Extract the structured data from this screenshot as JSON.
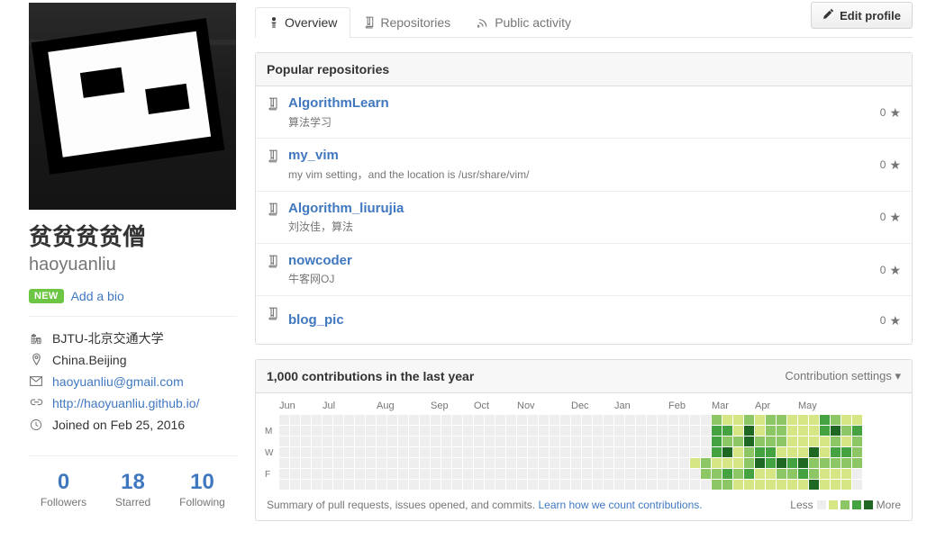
{
  "profile": {
    "display_name": "贫贫贫贫僧",
    "username": "haoyuanliu",
    "avatar_alt": "avatar-image",
    "new_badge": "NEW",
    "add_bio": "Add a bio",
    "meta": [
      {
        "icon": "organization-icon",
        "text": "BJTU-北京交通大学",
        "link": false
      },
      {
        "icon": "location-icon",
        "text": "China.Beijing",
        "link": false
      },
      {
        "icon": "mail-icon",
        "text": "haoyuanliu@gmail.com",
        "link": true
      },
      {
        "icon": "link-icon",
        "text": "http://haoyuanliu.github.io/",
        "link": true
      },
      {
        "icon": "clock-icon",
        "text": "Joined on Feb 25, 2016",
        "link": false
      }
    ],
    "stats": [
      {
        "num": "0",
        "label": "Followers"
      },
      {
        "num": "18",
        "label": "Starred"
      },
      {
        "num": "10",
        "label": "Following"
      }
    ]
  },
  "tabs": [
    {
      "label": "Overview",
      "icon": "person-icon",
      "active": true
    },
    {
      "label": "Repositories",
      "icon": "repo-icon",
      "active": false
    },
    {
      "label": "Public activity",
      "icon": "rss-icon",
      "active": false
    }
  ],
  "edit_profile": {
    "label": "Edit profile",
    "icon": "pencil-icon"
  },
  "popular_repositories": {
    "title": "Popular repositories",
    "items": [
      {
        "name": "AlgorithmLearn",
        "description": "算法学习",
        "stars": "0"
      },
      {
        "name": "my_vim",
        "description": "my vim setting，and the location is /usr/share/vim/",
        "stars": "0"
      },
      {
        "name": "Algorithm_liurujia",
        "description": "刘汝佳，算法",
        "stars": "0"
      },
      {
        "name": "nowcoder",
        "description": "牛客网OJ",
        "stars": "0"
      },
      {
        "name": "blog_pic",
        "description": "",
        "stars": "0"
      }
    ]
  },
  "contributions": {
    "title": "1,000 contributions in the last year",
    "settings_label": "Contribution settings",
    "summary_text": "Summary of pull requests, issues opened, and commits.",
    "learn_link": "Learn how we count contributions.",
    "legend_less": "Less",
    "legend_more": "More",
    "day_labels": [
      "",
      "M",
      "",
      "W",
      "",
      "F",
      ""
    ],
    "month_labels": [
      "Jun",
      "Jul",
      "Aug",
      "Sep",
      "Oct",
      "Nov",
      "Dec",
      "Jan",
      "Feb",
      "Mar",
      "Apr",
      "May"
    ],
    "palette": [
      "#eeeeee",
      "#d6e685",
      "#8cc665",
      "#44a340",
      "#1e6823"
    ],
    "chart_data": {
      "type": "heatmap",
      "title": "1,000 contributions in the last year",
      "xlabel": "",
      "ylabel": "",
      "weeks": 53,
      "days_per_week": 7,
      "levels": [
        0,
        1,
        2,
        3,
        4
      ],
      "level_colors": [
        "#eeeeee",
        "#d6e685",
        "#8cc665",
        "#44a340",
        "#1e6823"
      ],
      "month_positions": [
        {
          "label": "Jun",
          "week": 0
        },
        {
          "label": "Jul",
          "week": 4
        },
        {
          "label": "Aug",
          "week": 9
        },
        {
          "label": "Sep",
          "week": 14
        },
        {
          "label": "Oct",
          "week": 18
        },
        {
          "label": "Nov",
          "week": 22
        },
        {
          "label": "Dec",
          "week": 27
        },
        {
          "label": "Jan",
          "week": 31
        },
        {
          "label": "Feb",
          "week": 36
        },
        {
          "label": "Mar",
          "week": 40
        },
        {
          "label": "Apr",
          "week": 44
        },
        {
          "label": "May",
          "week": 48
        }
      ],
      "matrix": [
        [
          0,
          0,
          0,
          0,
          0,
          0,
          0
        ],
        [
          0,
          0,
          0,
          0,
          0,
          0,
          0
        ],
        [
          0,
          0,
          0,
          0,
          0,
          0,
          0
        ],
        [
          0,
          0,
          0,
          0,
          0,
          0,
          0
        ],
        [
          0,
          0,
          0,
          0,
          0,
          0,
          0
        ],
        [
          0,
          0,
          0,
          0,
          0,
          0,
          0
        ],
        [
          0,
          0,
          0,
          0,
          0,
          0,
          0
        ],
        [
          0,
          0,
          0,
          0,
          0,
          0,
          0
        ],
        [
          0,
          0,
          0,
          0,
          0,
          0,
          0
        ],
        [
          0,
          0,
          0,
          0,
          0,
          0,
          0
        ],
        [
          0,
          0,
          0,
          0,
          0,
          0,
          0
        ],
        [
          0,
          0,
          0,
          0,
          0,
          0,
          0
        ],
        [
          0,
          0,
          0,
          0,
          0,
          0,
          0
        ],
        [
          0,
          0,
          0,
          0,
          0,
          0,
          0
        ],
        [
          0,
          0,
          0,
          0,
          0,
          0,
          0
        ],
        [
          0,
          0,
          0,
          0,
          0,
          0,
          0
        ],
        [
          0,
          0,
          0,
          0,
          0,
          0,
          0
        ],
        [
          0,
          0,
          0,
          0,
          0,
          0,
          0
        ],
        [
          0,
          0,
          0,
          0,
          0,
          0,
          0
        ],
        [
          0,
          0,
          0,
          0,
          0,
          0,
          0
        ],
        [
          0,
          0,
          0,
          0,
          0,
          0,
          0
        ],
        [
          0,
          0,
          0,
          0,
          0,
          0,
          0
        ],
        [
          0,
          0,
          0,
          0,
          0,
          0,
          0
        ],
        [
          0,
          0,
          0,
          0,
          0,
          0,
          0
        ],
        [
          0,
          0,
          0,
          0,
          0,
          0,
          0
        ],
        [
          0,
          0,
          0,
          0,
          0,
          0,
          0
        ],
        [
          0,
          0,
          0,
          0,
          0,
          0,
          0
        ],
        [
          0,
          0,
          0,
          0,
          0,
          0,
          0
        ],
        [
          0,
          0,
          0,
          0,
          0,
          0,
          0
        ],
        [
          0,
          0,
          0,
          0,
          0,
          0,
          0
        ],
        [
          0,
          0,
          0,
          0,
          0,
          0,
          0
        ],
        [
          0,
          0,
          0,
          0,
          0,
          0,
          0
        ],
        [
          0,
          0,
          0,
          0,
          0,
          0,
          0
        ],
        [
          0,
          0,
          0,
          0,
          0,
          0,
          0
        ],
        [
          0,
          0,
          0,
          0,
          0,
          0,
          0
        ],
        [
          0,
          0,
          0,
          0,
          0,
          0,
          0
        ],
        [
          0,
          0,
          0,
          0,
          0,
          0,
          0
        ],
        [
          0,
          0,
          0,
          0,
          0,
          0,
          0
        ],
        [
          0,
          0,
          0,
          0,
          1,
          0,
          0
        ],
        [
          0,
          0,
          0,
          0,
          2,
          2,
          0
        ],
        [
          2,
          3,
          3,
          3,
          1,
          2,
          2
        ],
        [
          1,
          3,
          2,
          4,
          1,
          3,
          2
        ],
        [
          1,
          1,
          2,
          1,
          1,
          2,
          1
        ],
        [
          2,
          4,
          4,
          2,
          2,
          3,
          1
        ],
        [
          1,
          1,
          2,
          3,
          4,
          1,
          1
        ],
        [
          2,
          2,
          2,
          3,
          3,
          1,
          1
        ],
        [
          2,
          2,
          2,
          1,
          4,
          2,
          1
        ],
        [
          1,
          1,
          1,
          1,
          3,
          2,
          1
        ],
        [
          1,
          1,
          1,
          1,
          4,
          3,
          1
        ],
        [
          1,
          1,
          1,
          4,
          2,
          2,
          4
        ],
        [
          3,
          3,
          1,
          1,
          2,
          1,
          1
        ],
        [
          2,
          4,
          2,
          3,
          2,
          1,
          1
        ],
        [
          1,
          2,
          1,
          3,
          2,
          1,
          1
        ],
        [
          1,
          3,
          2,
          2,
          2,
          0,
          0
        ]
      ]
    }
  }
}
